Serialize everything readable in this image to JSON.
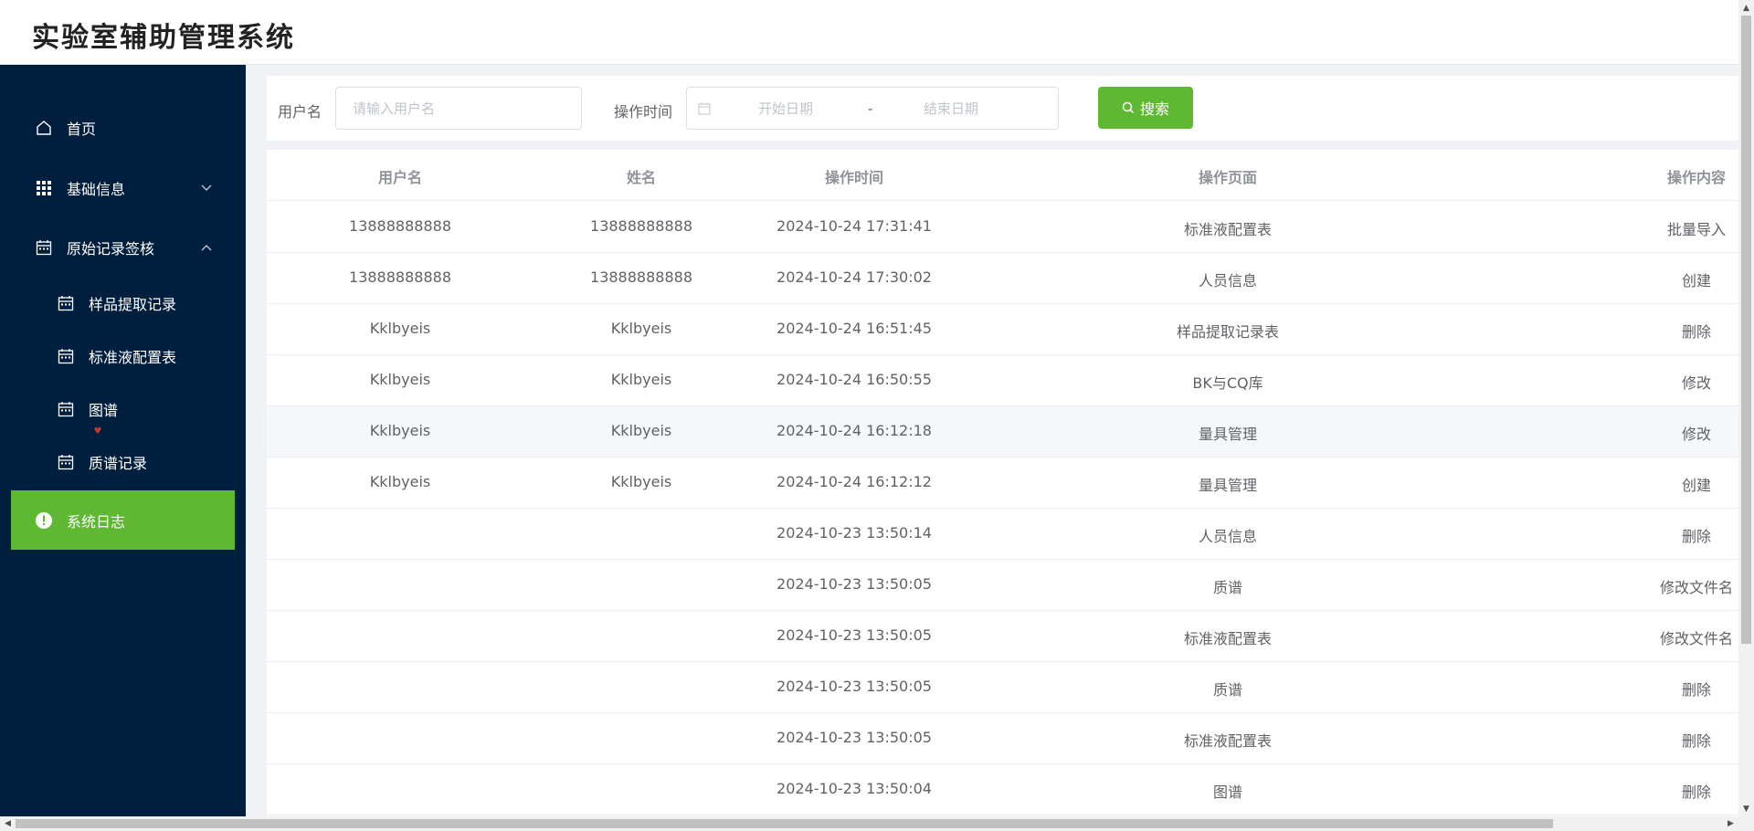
{
  "app": {
    "title": "实验室辅助管理系统"
  },
  "sidebar": {
    "items": [
      {
        "label": "首页",
        "icon": "home-icon"
      },
      {
        "label": "基础信息",
        "icon": "grid-icon"
      },
      {
        "label": "原始记录签核",
        "icon": "calendar-icon"
      }
    ],
    "sub_items": [
      {
        "label": "样品提取记录",
        "icon": "calendar-icon"
      },
      {
        "label": "标准液配置表",
        "icon": "calendar-icon"
      },
      {
        "label": "图谱",
        "icon": "calendar-icon"
      },
      {
        "label": "质谱记录",
        "icon": "calendar-icon"
      }
    ],
    "active": {
      "label": "系统日志",
      "icon": "info-circle-icon"
    },
    "colors": {
      "background": "#001e3d",
      "active": "#5fb832"
    }
  },
  "search": {
    "username_label": "用户名",
    "username_placeholder": "请输入用户名",
    "time_label": "操作时间",
    "start_placeholder": "开始日期",
    "separator": "-",
    "end_placeholder": "结束日期",
    "button_label": "搜索"
  },
  "table": {
    "columns": [
      "用户名",
      "姓名",
      "操作时间",
      "操作页面",
      "操作内容"
    ],
    "rows": [
      [
        "13888888888",
        "13888888888",
        "2024-10-24 17:31:41",
        "标准液配置表",
        "批量导入"
      ],
      [
        "13888888888",
        "13888888888",
        "2024-10-24 17:30:02",
        "人员信息",
        "创建"
      ],
      [
        "Kklbyeis",
        "Kklbyeis",
        "2024-10-24 16:51:45",
        "样品提取记录表",
        "删除"
      ],
      [
        "Kklbyeis",
        "Kklbyeis",
        "2024-10-24 16:50:55",
        "BK与CQ库",
        "修改"
      ],
      [
        "Kklbyeis",
        "Kklbyeis",
        "2024-10-24 16:12:18",
        "量具管理",
        "修改"
      ],
      [
        "Kklbyeis",
        "Kklbyeis",
        "2024-10-24 16:12:12",
        "量具管理",
        "创建"
      ],
      [
        "",
        "",
        "2024-10-23 13:50:14",
        "人员信息",
        "删除"
      ],
      [
        "",
        "",
        "2024-10-23 13:50:05",
        "质谱",
        "修改文件名"
      ],
      [
        "",
        "",
        "2024-10-23 13:50:05",
        "标准液配置表",
        "修改文件名"
      ],
      [
        "",
        "",
        "2024-10-23 13:50:05",
        "质谱",
        "删除"
      ],
      [
        "",
        "",
        "2024-10-23 13:50:05",
        "标准液配置表",
        "删除"
      ],
      [
        "",
        "",
        "2024-10-23 13:50:04",
        "图谱",
        "删除"
      ]
    ]
  }
}
